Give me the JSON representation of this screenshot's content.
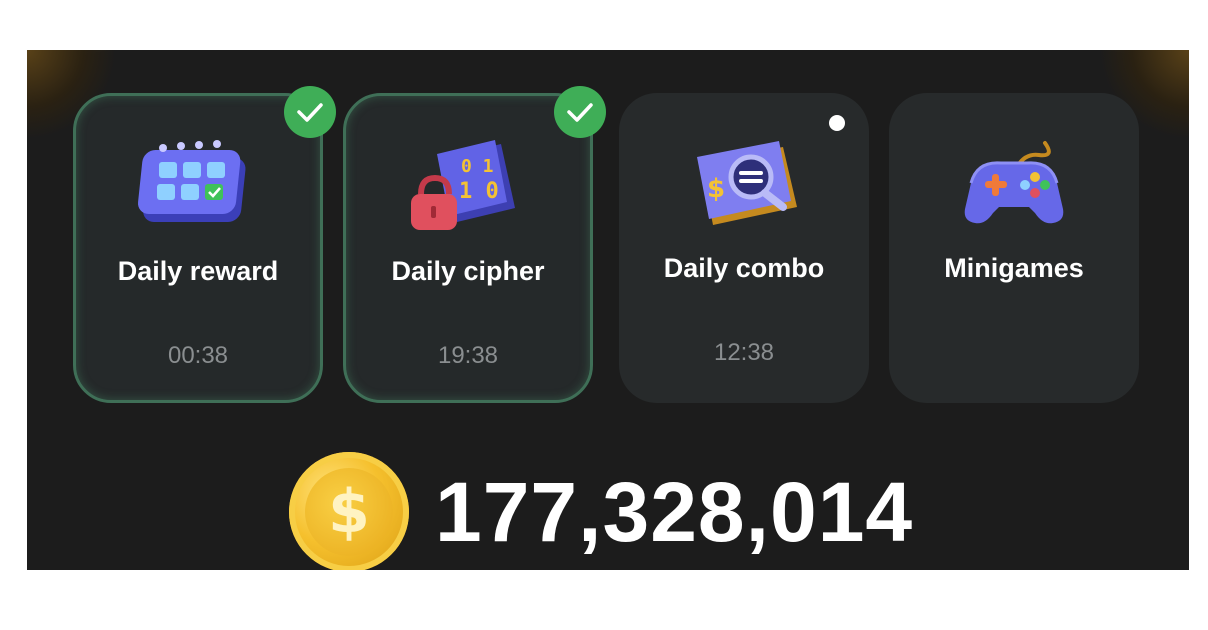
{
  "cards": [
    {
      "title": "Daily reward",
      "timer": "00:38",
      "completed": true,
      "icon": "calendar-icon"
    },
    {
      "title": "Daily cipher",
      "timer": "19:38",
      "completed": true,
      "icon": "cipher-lock-icon"
    },
    {
      "title": "Daily combo",
      "timer": "12:38",
      "completed": false,
      "has_notification_dot": true,
      "icon": "combo-magnifier-icon"
    },
    {
      "title": "Minigames",
      "timer": "",
      "completed": false,
      "icon": "gamepad-icon"
    }
  ],
  "balance": {
    "value": "177,328,014",
    "coin_symbol": "$",
    "icon": "coin-icon"
  },
  "colors": {
    "panel_bg": "#1e1e1e",
    "card_bg": "#272a2b",
    "check_green": "#3fae57",
    "timer_gray": "#8a8e90",
    "coin_gold": "#f5c02d"
  }
}
